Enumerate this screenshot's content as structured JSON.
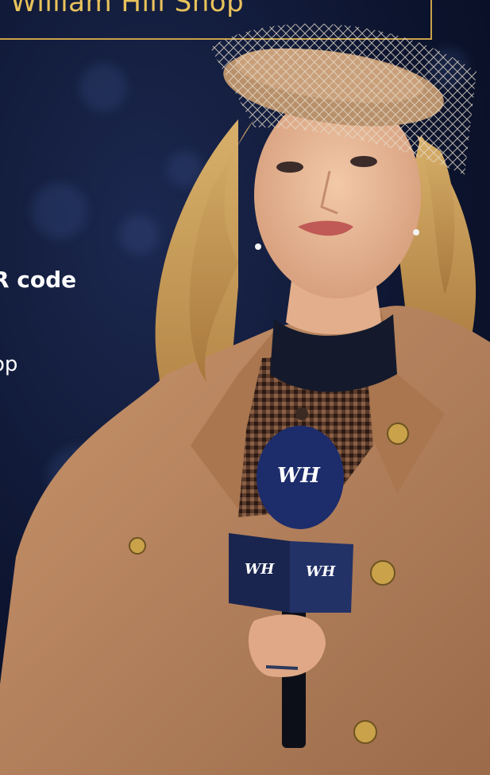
{
  "banner": {
    "text": "William Hill Shop"
  },
  "promo": {
    "qr_line": "R code",
    "app_line": "op"
  },
  "microphone": {
    "logo_text": "WH"
  },
  "colors": {
    "background_dark": "#0d1530",
    "gold_accent": "#c9a24a",
    "banner_text": "#e8c25b",
    "mic_blue": "#1d2c6b",
    "coat_camel": "#b88460"
  }
}
